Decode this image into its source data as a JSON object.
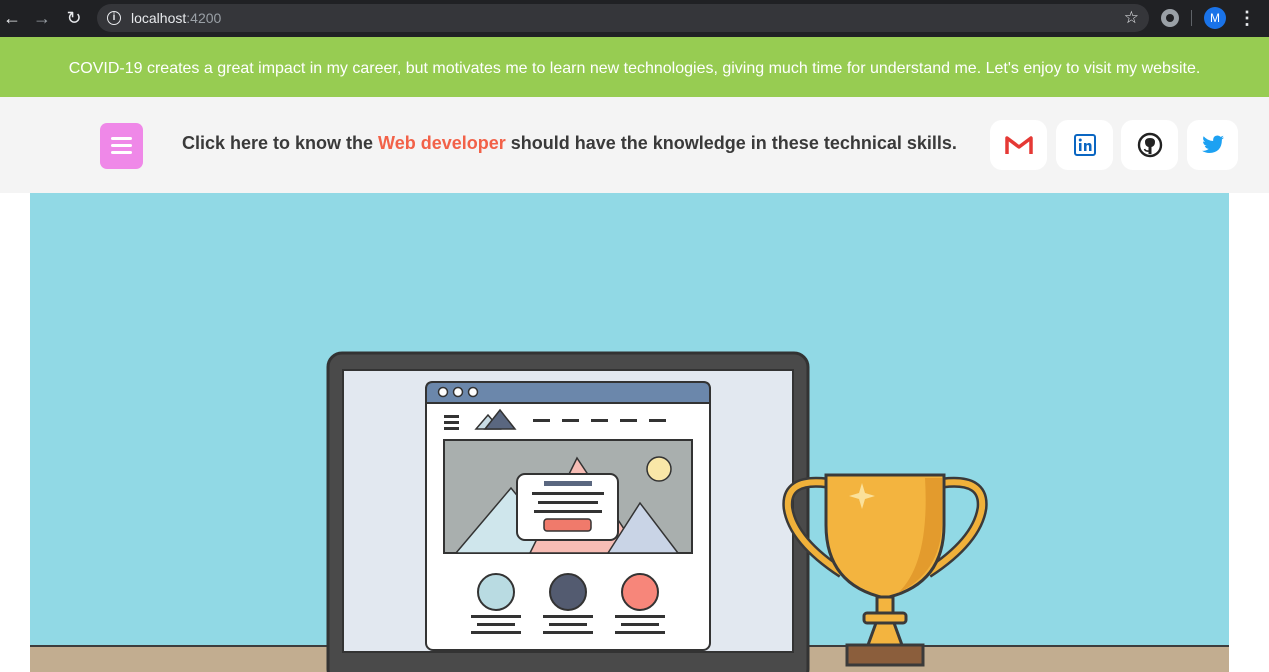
{
  "browser": {
    "url_host": "localhost",
    "url_port": ":4200",
    "avatar_initial": "M"
  },
  "banner": {
    "text": "COVID-19 creates a great impact in my career, but motivates me to learn new technologies, giving much time for understand me. Let's enjoy to visit my website."
  },
  "header": {
    "text_before": "Click here to know the ",
    "highlight": "Web developer",
    "text_after": " should have the knowledge in these technical skills.",
    "social": [
      "gmail-icon",
      "linkedin-icon",
      "github-icon",
      "twitter-icon"
    ]
  },
  "colors": {
    "banner_bg": "#97cc52",
    "menu_button": "#ef88e8",
    "highlight": "#f26148",
    "hero_bg": "#91d9e5"
  }
}
